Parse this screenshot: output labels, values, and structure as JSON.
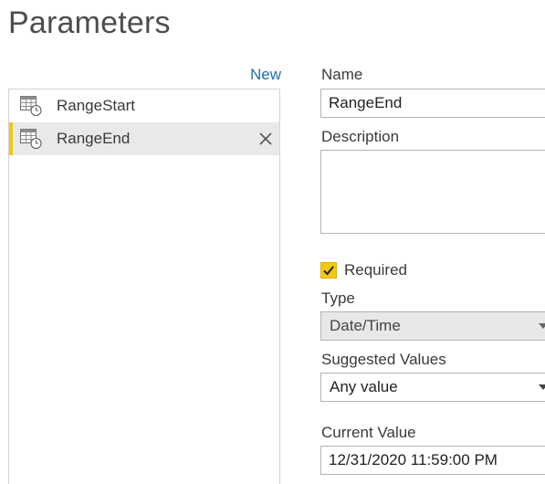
{
  "title": "Parameters",
  "new_label": "New",
  "parameters": [
    {
      "name": "RangeStart",
      "selected": false
    },
    {
      "name": "RangeEnd",
      "selected": true
    }
  ],
  "icons": {
    "parameter": "table-clock-icon",
    "delete": "close-icon",
    "checkbox": "checkmark-icon",
    "dropdown": "chevron-down-icon"
  },
  "form": {
    "name_label": "Name",
    "name_value": "RangeEnd",
    "description_label": "Description",
    "description_value": "",
    "required_label": "Required",
    "required_checked": true,
    "type_label": "Type",
    "type_value": "Date/Time",
    "suggested_label": "Suggested Values",
    "suggested_value": "Any value",
    "current_label": "Current Value",
    "current_value": "12/31/2020 11:59:00 PM"
  },
  "colors": {
    "accent": "#f2c811",
    "link": "#1e6fa8",
    "selected_bg": "#e9e9e9"
  }
}
